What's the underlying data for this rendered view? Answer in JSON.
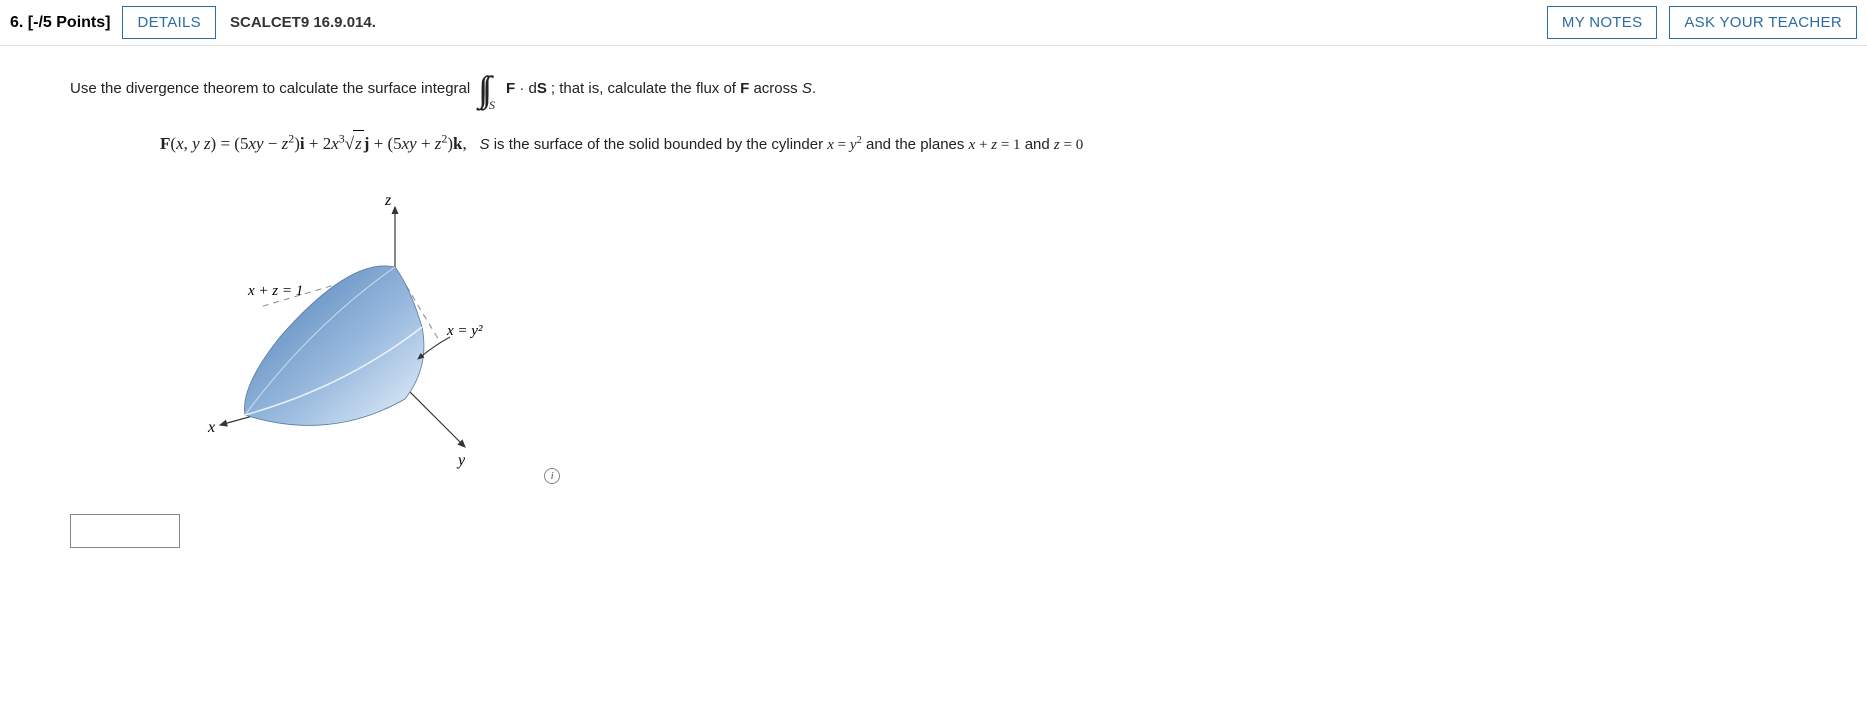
{
  "header": {
    "number": "6.",
    "points": "[-/5 Points]",
    "details": "DETAILS",
    "code": "SCALCET9 16.9.014.",
    "mynotes": "MY NOTES",
    "askteacher": "ASK YOUR TEACHER"
  },
  "prompt": {
    "pre": "Use the divergence theorem to calculate the surface integral",
    "integrand": "F · dS",
    "post": "; that is, calculate the flux of F across S.",
    "int_sub": "S"
  },
  "formula": {
    "func_head": "F(x, y z) = ",
    "expr_html": "(5<span class='ital'>xy</span> − <span class='ital'>z</span><sup>2</sup>)<span class='bold'>i</span> + 2<span class='ital'>x</span><sup>3</sup>√<span class='sqrt ital'>z</span><span class='bold'>j</span> + (5<span class='ital'>xy</span> + <span class='ital'>z</span><sup>2</sup>)<span class='bold'>k</span>,",
    "rest_pre": "S is the surface of the solid bounded by the cylinder ",
    "rest_mid": "x = y",
    "rest_sup": "2",
    "rest_post": " and the planes x + z = 1 and z = 0"
  },
  "figure": {
    "z_label": "z",
    "xz_label": "x + z = 1",
    "xy_label": "x = y²",
    "x_label": "x",
    "y_label": "y"
  },
  "info_icon": "i",
  "answer_value": ""
}
